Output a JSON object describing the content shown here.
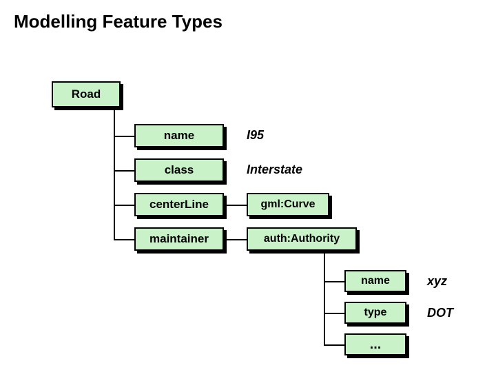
{
  "title": "Modelling Feature Types",
  "root": {
    "label": "Road"
  },
  "props": [
    {
      "label": "name",
      "value": "I95"
    },
    {
      "label": "class",
      "value": "Interstate"
    },
    {
      "label": "centerLine",
      "link": "gml:Curve"
    },
    {
      "label": "maintainer",
      "link": "auth:Authority"
    }
  ],
  "authority_props": [
    {
      "label": "name",
      "value": "xyz"
    },
    {
      "label": "type",
      "value": "DOT"
    },
    {
      "label": "..."
    }
  ]
}
